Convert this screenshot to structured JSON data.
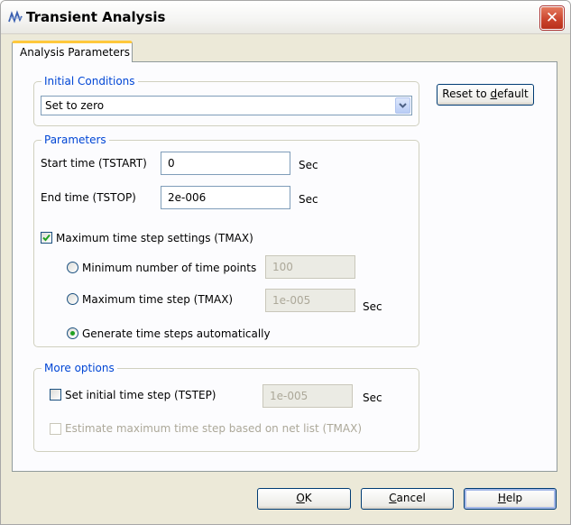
{
  "window": {
    "title": "Transient Analysis"
  },
  "tabs": [
    {
      "label": "Analysis Parameters"
    }
  ],
  "initial_conditions": {
    "legend": "Initial Conditions",
    "selected": "Set to zero"
  },
  "reset_button": {
    "label_pre": "Reset to ",
    "label_accel": "d",
    "label_post": "efault"
  },
  "parameters": {
    "legend": "Parameters",
    "start_label": "Start time (TSTART)",
    "start_value": "0",
    "start_unit": "Sec",
    "end_label": "End time (TSTOP)",
    "end_value": "2e-006",
    "end_unit": "Sec",
    "max_step_checkbox_label": "Maximum time step settings (TMAX)",
    "max_step_checked": true,
    "radio_min_points_label": "Minimum number of time points",
    "min_points_value": "100",
    "radio_max_step_label": "Maximum time step (TMAX)",
    "max_step_value": "1e-005",
    "max_step_unit": "Sec",
    "radio_auto_label": "Generate time steps automatically",
    "selected_radio": "auto"
  },
  "more_options": {
    "legend": "More options",
    "initial_step_label": "Set initial time step (TSTEP)",
    "initial_step_checked": false,
    "initial_step_value": "1e-005",
    "initial_step_unit": "Sec",
    "estimate_label": "Estimate maximum time step based on net list (TMAX)",
    "estimate_enabled": false
  },
  "footer": {
    "ok_accel": "O",
    "ok_post": "K",
    "cancel_accel": "C",
    "cancel_post": "ancel",
    "help_accel": "H",
    "help_post": "elp"
  },
  "colors": {
    "legend_blue": "#0046d5",
    "tab_accent": "#ffc83c",
    "close_red": "#c9422b",
    "radio_green": "#21a121",
    "check_green": "#21a121"
  },
  "icons": {
    "app": "transient-waveform-icon",
    "close": "close-icon",
    "dropdown": "chevron-down-icon",
    "check": "check-icon"
  }
}
